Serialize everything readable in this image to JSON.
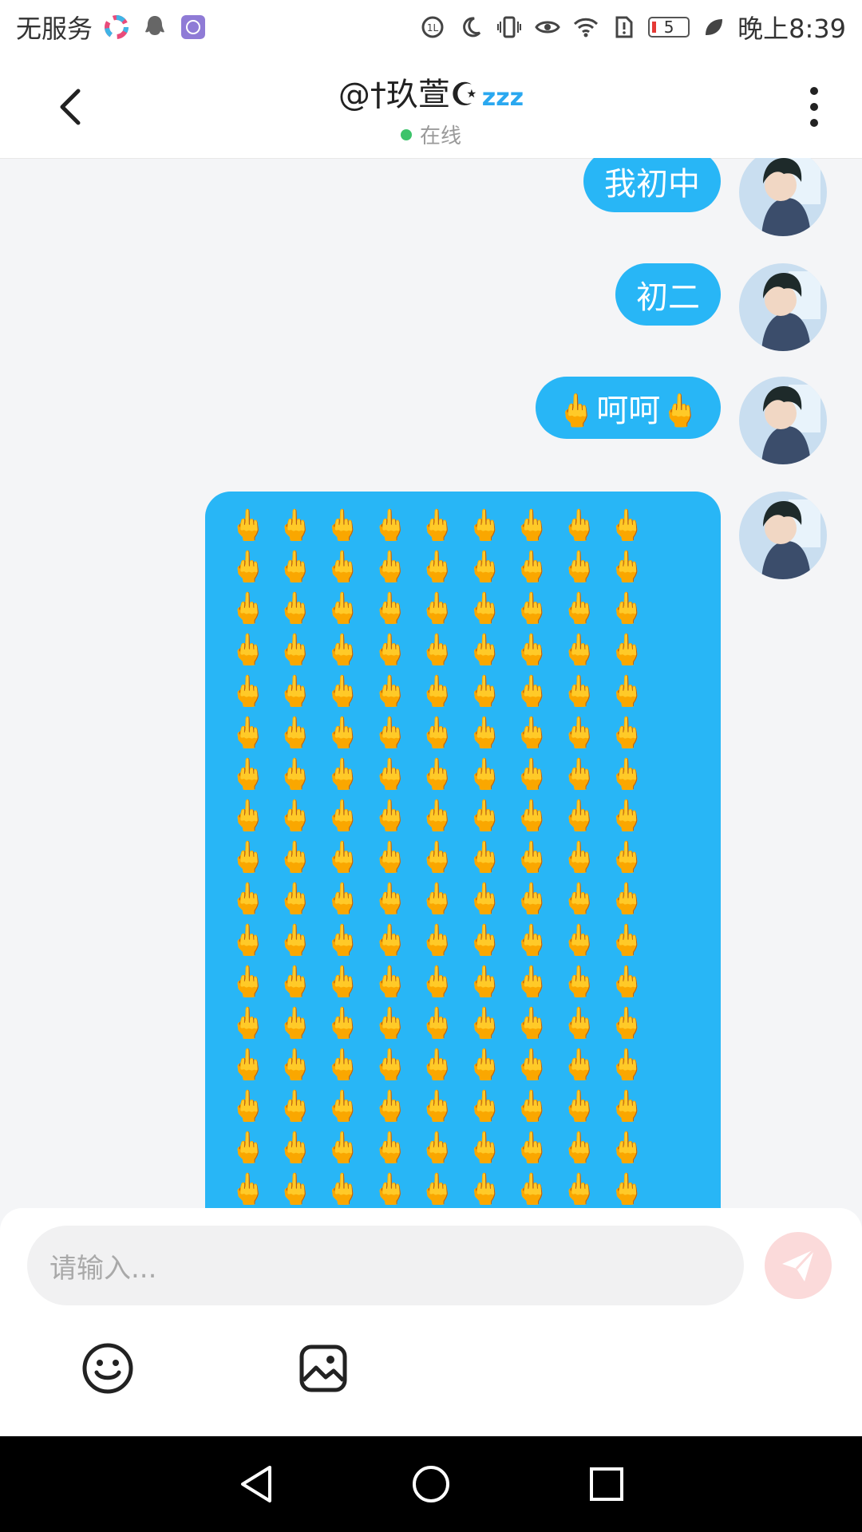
{
  "status_bar": {
    "carrier": "无服务",
    "battery_level": "5",
    "time": "晚上8:39",
    "icons": [
      "colorful-app-icon",
      "qq-icon",
      "app-icon",
      "hd-icon",
      "moon-icon",
      "vibrate-icon",
      "eye-icon",
      "wifi-icon",
      "alert-sim-icon",
      "battery-icon",
      "leaf-icon"
    ]
  },
  "header": {
    "title": "@†玖萱☪",
    "title_suffix": "zzz",
    "status": "在线"
  },
  "messages": [
    {
      "text": "我初中",
      "sender": "self"
    },
    {
      "text": "初二",
      "sender": "self"
    },
    {
      "text": "🖕呵呵🖕",
      "sender": "self"
    },
    {
      "text": "🖕🖕🖕🖕🖕🖕🖕🖕🖕🖕🖕🖕🖕🖕🖕🖕🖕🖕🖕🖕🖕🖕🖕🖕🖕🖕🖕🖕🖕🖕🖕🖕🖕🖕🖕🖕🖕🖕🖕🖕🖕🖕🖕🖕🖕🖕🖕🖕🖕🖕🖕🖕🖕🖕🖕🖕🖕🖕🖕🖕🖕🖕🖕🖕🖕🖕🖕🖕🖕🖕🖕🖕🖕🖕🖕🖕🖕🖕🖕🖕🖕🖕🖕🖕🖕🖕🖕🖕🖕🖕🖕🖕🖕🖕🖕🖕🖕🖕🖕🖕🖕🖕🖕🖕🖕🖕🖕🖕🖕🖕🖕🖕🖕🖕🖕🖕🖕🖕🖕🖕🖕🖕🖕🖕🖕🖕🖕🖕🖕🖕🖕🖕🖕🖕🖕🖕🖕🖕🖕🖕🖕🖕🖕🖕🖕🖕🖕🖕🖕🖕🖕🖕🖕🖕🖕🖕🖕🖕🖕🖕🖕🖕🖕🖕🖕🖕🖕🖕🖕🖕🖕🖕🖕🖕🖕🖕🖕🖕🖕🖕🖕🖕🖕🖕🖕🖕🖕🖕🖕🖕🖕🖕🖕🖕",
      "sender": "self"
    }
  ],
  "input": {
    "placeholder": "请输入..."
  },
  "colors": {
    "bubble": "#28b6f6",
    "send_button": "#fbdada",
    "online_dot": "#3cc36a"
  }
}
